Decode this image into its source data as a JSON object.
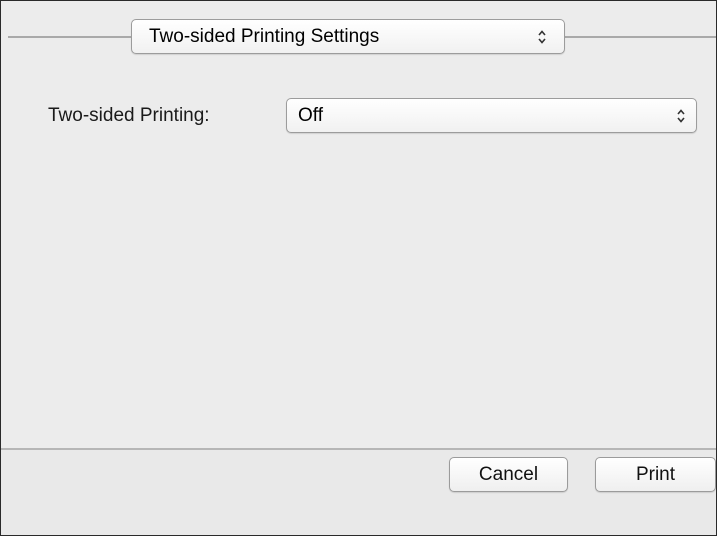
{
  "section_popup": {
    "selected": "Two-sided Printing Settings",
    "icon": "updown-arrows-icon"
  },
  "two_sided": {
    "label": "Two-sided Printing:",
    "selected": "Off",
    "icon": "updown-arrows-icon"
  },
  "buttons": {
    "cancel": "Cancel",
    "print": "Print"
  }
}
